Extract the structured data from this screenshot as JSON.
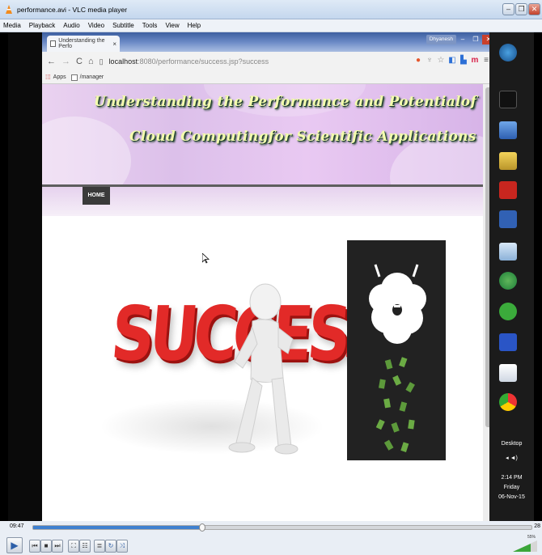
{
  "vlc": {
    "title": "performance.avi - VLC media player",
    "window_buttons": [
      "–",
      "❐",
      "✕"
    ],
    "menu": [
      "Media",
      "Playback",
      "Audio",
      "Video",
      "Subtitle",
      "Tools",
      "View",
      "Help"
    ]
  },
  "browser": {
    "tab_title": "Understanding the Perfo",
    "tab_close": "×",
    "profile_label": "Dhyanesh",
    "url_host": "localhost",
    "url_rest": ":8080/performance/success.jsp?success",
    "bookmarks": {
      "apps": "Apps",
      "manager": "/manager"
    }
  },
  "page": {
    "title_line1": "Understanding the Performance and Potentialof",
    "title_line2": "Cloud Computingfor Scientific Applications",
    "nav_home": "HOME",
    "success_text": "SUCCESS"
  },
  "taskbar": {
    "label": "Desktop",
    "time": "2:14 PM",
    "day": "Friday",
    "date": "06-Nov-15"
  },
  "player": {
    "elapsed": "09:47",
    "total": "28",
    "progress": 0.34,
    "volume_label": "55%",
    "accent": "#3f80cf"
  }
}
